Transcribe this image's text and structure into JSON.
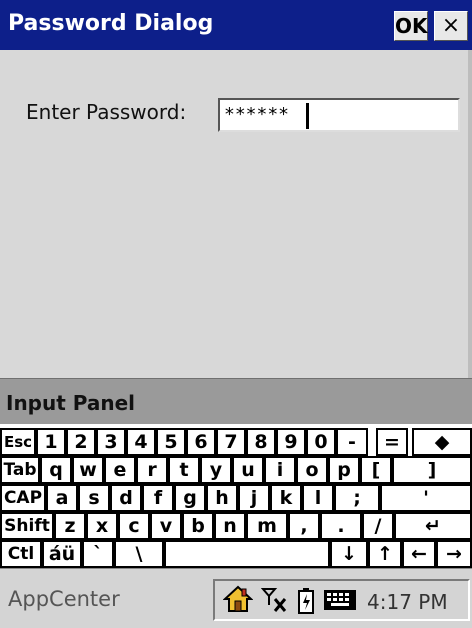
{
  "window": {
    "title": "Password Dialog",
    "ok_label": "OK",
    "close_label": "×"
  },
  "form": {
    "label": "Enter Password:",
    "password_value": "******"
  },
  "input_panel": {
    "title": "Input Panel"
  },
  "keyboard": {
    "rows": [
      [
        "Esc",
        "1",
        "2",
        "3",
        "4",
        "5",
        "6",
        "7",
        "8",
        "9",
        "0",
        "-",
        "=",
        "◆"
      ],
      [
        "Tab",
        "q",
        "w",
        "e",
        "r",
        "t",
        "y",
        "u",
        "i",
        "o",
        "p",
        "[",
        "]"
      ],
      [
        "CAP",
        "a",
        "s",
        "d",
        "f",
        "g",
        "h",
        "j",
        "k",
        "l",
        ";",
        "'"
      ],
      [
        "Shift",
        "z",
        "x",
        "c",
        "v",
        "b",
        "n",
        "m",
        ",",
        ".",
        "/",
        "↵"
      ],
      [
        "Ctl",
        "áü",
        "`",
        "\\",
        "",
        "↓",
        "↑",
        "←",
        "→"
      ]
    ]
  },
  "taskbar": {
    "start_label": "AppCenter",
    "clock": "4:17 PM",
    "tray_icons": [
      "home-icon",
      "signal-off-icon",
      "battery-icon",
      "keyboard-icon"
    ]
  },
  "colors": {
    "titlebar": "#0d1f8a",
    "dialog_bg": "#d8d8d8",
    "panel_bar": "#9a9a9a"
  }
}
